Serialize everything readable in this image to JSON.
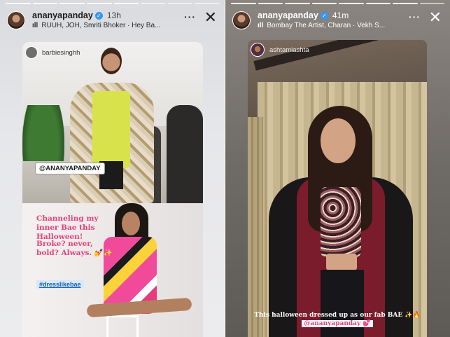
{
  "left_story": {
    "username": "ananyapanday",
    "time": "13h",
    "music": "RUUH, JOH, Smriti Bhoker · Hey Ba...",
    "more_icon": "more-horizontal-icon",
    "close_icon": "close-icon",
    "repost_top": {
      "handle": "barbiesinghh",
      "mention": "@ANANYAPANDAY"
    },
    "repost_bottom": {
      "title": "Channeling my inner Bae this Halloween!",
      "subtitle": "Broke? never, bold? Always. 💅✨",
      "hashtag": "#dresslikebae"
    }
  },
  "right_story": {
    "username": "ananyapanday",
    "time": "41m",
    "music": "Bombay The Artist, Charan · Vekh S...",
    "more_icon": "more-horizontal-icon",
    "close_icon": "close-icon",
    "repost_handle": "ashtamiashta",
    "caption_line1": "This halloween dressed up as our fab BAE ✨🔥",
    "caption_line2": "@ananyapanday 💕"
  },
  "colors": {
    "verified_blue": "#3897f0",
    "accent_pink": "#e8427d"
  }
}
